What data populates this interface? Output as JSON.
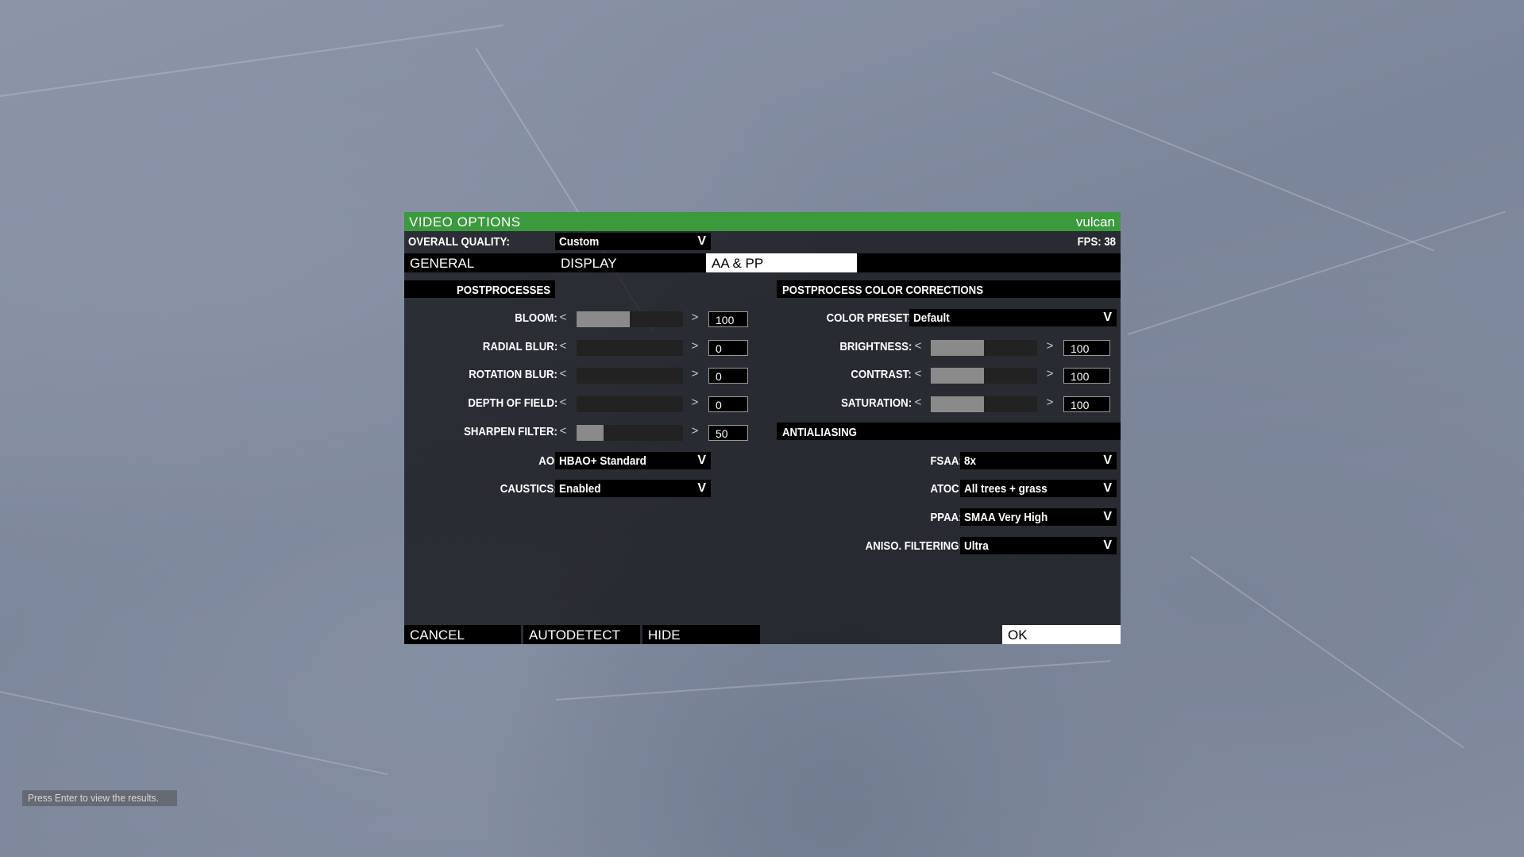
{
  "window": {
    "title": "VIDEO OPTIONS",
    "renderer": "vulcan"
  },
  "overall_quality": {
    "label": "OVERALL QUALITY:",
    "value": "Custom",
    "fps": "FPS: 38"
  },
  "tabs": [
    {
      "label": "GENERAL",
      "active": false
    },
    {
      "label": "DISPLAY",
      "active": false
    },
    {
      "label": "AA & PP",
      "active": true
    }
  ],
  "postprocesses": {
    "header": "POSTPROCESSES",
    "sliders": [
      {
        "label": "BLOOM:",
        "value": "100",
        "fill": 0.5
      },
      {
        "label": "RADIAL BLUR:",
        "value": "0",
        "fill": 0
      },
      {
        "label": "ROTATION BLUR:",
        "value": "0",
        "fill": 0
      },
      {
        "label": "DEPTH OF FIELD:",
        "value": "0",
        "fill": 0
      },
      {
        "label": "SHARPEN FILTER:",
        "value": "50",
        "fill": 0.25
      }
    ],
    "dropdowns": [
      {
        "label": "AO:",
        "value": "HBAO+ Standard"
      },
      {
        "label": "CAUSTICS:",
        "value": "Enabled"
      }
    ]
  },
  "color_corrections": {
    "header": "POSTPROCESS COLOR CORRECTIONS",
    "preset": {
      "label": "COLOR PRESET:",
      "value": "Default"
    },
    "sliders": [
      {
        "label": "BRIGHTNESS:",
        "value": "100",
        "fill": 0.5
      },
      {
        "label": "CONTRAST:",
        "value": "100",
        "fill": 0.5
      },
      {
        "label": "SATURATION:",
        "value": "100",
        "fill": 0.5
      }
    ]
  },
  "antialiasing": {
    "header": "ANTIALIASING",
    "dropdowns": [
      {
        "label": "FSAA:",
        "value": "8x"
      },
      {
        "label": "ATOC:",
        "value": "All trees + grass"
      },
      {
        "label": "PPAA:",
        "value": "SMAA Very High"
      },
      {
        "label": "ANISO. FILTERING:",
        "value": "Ultra"
      }
    ]
  },
  "glyphs": {
    "left": "<",
    "right": ">",
    "dropdown": "V"
  },
  "buttons": {
    "cancel": "CANCEL",
    "autodetect": "AUTODETECT",
    "hide": "HIDE",
    "ok": "OK"
  },
  "hint": "Press Enter to view the results."
}
